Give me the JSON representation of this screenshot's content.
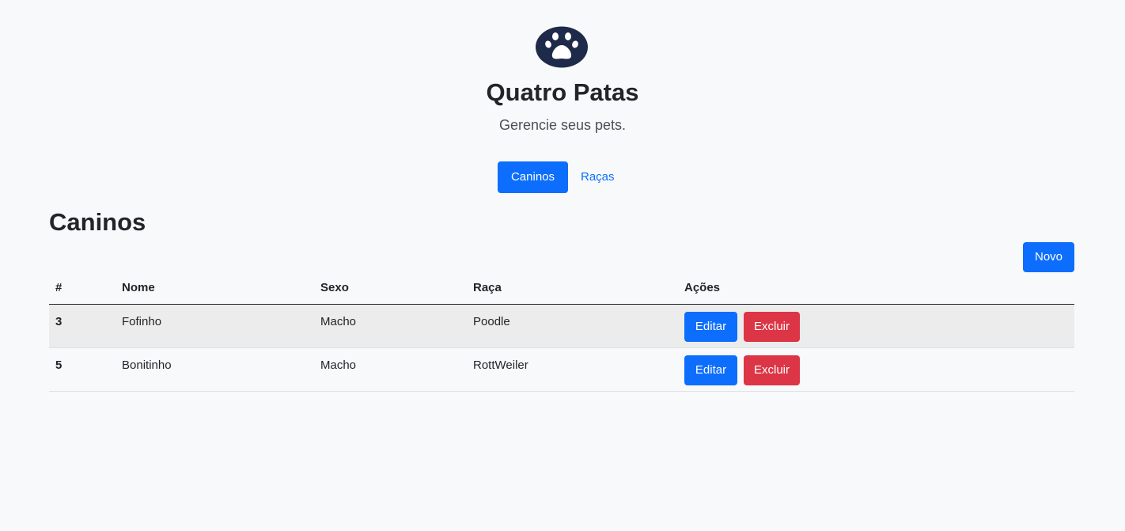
{
  "app": {
    "title": "Quatro Patas",
    "subtitle": "Gerencie seus pets.",
    "logo_icon": "paw-icon",
    "logo_color": "#1e2a4a"
  },
  "nav": {
    "items": [
      {
        "label": "Caninos",
        "active": true
      },
      {
        "label": "Raças",
        "active": false
      }
    ]
  },
  "section": {
    "title": "Caninos",
    "new_button_label": "Novo"
  },
  "table": {
    "headers": [
      "#",
      "Nome",
      "Sexo",
      "Raça",
      "Ações"
    ],
    "rows": [
      {
        "id": "3",
        "name": "Fofinho",
        "sex": "Macho",
        "breed": "Poodle",
        "edit_label": "Editar",
        "delete_label": "Excluir"
      },
      {
        "id": "5",
        "name": "Bonitinho",
        "sex": "Macho",
        "breed": "RottWeiler",
        "edit_label": "Editar",
        "delete_label": "Excluir"
      }
    ]
  },
  "colors": {
    "primary": "#0d6efd",
    "danger": "#dc3545",
    "background": "#f8f9fa"
  }
}
